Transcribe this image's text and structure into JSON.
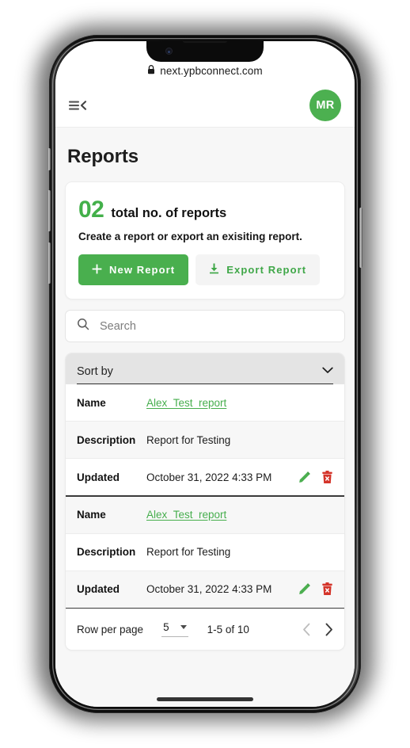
{
  "browser": {
    "url": "next.ypbconnect.com",
    "lock_icon": "lock-icon"
  },
  "appbar": {
    "menu_icon": "menu-collapse-icon",
    "avatar_initials": "MR",
    "avatar_color": "#4CB050"
  },
  "page": {
    "title": "Reports"
  },
  "stat_card": {
    "count": "02",
    "count_label": "total no. of reports",
    "subtitle": "Create a report or export an exisiting report.",
    "new_report_label": "New Report",
    "new_report_icon": "plus-icon",
    "export_report_label": "Export Report",
    "export_report_icon": "download-icon"
  },
  "search": {
    "placeholder": "Search",
    "value": "",
    "icon": "search-icon"
  },
  "sort": {
    "label": "Sort by",
    "icon": "chevron-down-icon"
  },
  "table": {
    "keys": {
      "name": "Name",
      "description": "Description",
      "updated": "Updated"
    },
    "edit_icon": "pencil-icon",
    "delete_icon": "trash-icon",
    "rows": [
      {
        "name": "Alex_Test_report",
        "description": "Report for Testing",
        "updated": "October 31, 2022 4:33 PM"
      },
      {
        "name": "Alex_Test_report",
        "description": "Report for Testing",
        "updated": "October 31, 2022 4:33 PM"
      }
    ]
  },
  "pagination": {
    "rows_label": "Row per page",
    "rows_value": "5",
    "range": "1-5 of 10",
    "prev_icon": "chevron-left-icon",
    "next_icon": "chevron-right-icon"
  },
  "colors": {
    "green": "#43B04A",
    "green_button": "#49AF4E",
    "red": "#D4342A"
  }
}
